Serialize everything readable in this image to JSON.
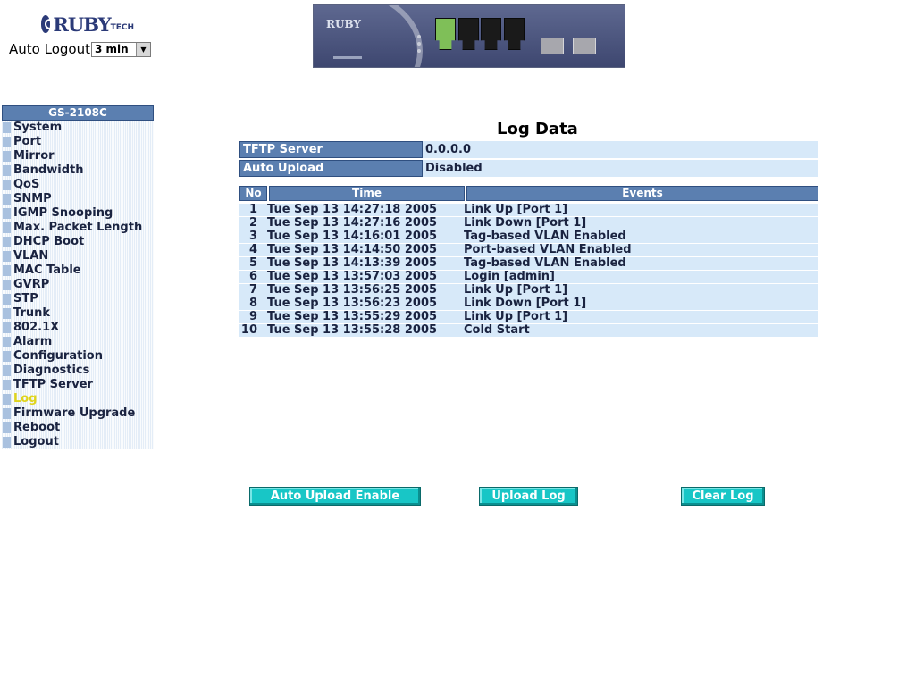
{
  "header": {
    "logo_text": "RUBY",
    "logo_sub": "TECH",
    "auto_logout_label": "Auto Logout",
    "auto_logout_value": "3 min",
    "device_logo": "RUBY"
  },
  "sidebar": {
    "title": "GS-2108C",
    "items": [
      {
        "label": "System"
      },
      {
        "label": "Port"
      },
      {
        "label": "Mirror"
      },
      {
        "label": "Bandwidth"
      },
      {
        "label": "QoS"
      },
      {
        "label": "SNMP"
      },
      {
        "label": "IGMP Snooping"
      },
      {
        "label": "Max. Packet Length"
      },
      {
        "label": "DHCP Boot"
      },
      {
        "label": "VLAN"
      },
      {
        "label": "MAC Table"
      },
      {
        "label": "GVRP"
      },
      {
        "label": "STP"
      },
      {
        "label": "Trunk"
      },
      {
        "label": "802.1X"
      },
      {
        "label": "Alarm"
      },
      {
        "label": "Configuration"
      },
      {
        "label": "Diagnostics"
      },
      {
        "label": "TFTP Server"
      },
      {
        "label": "Log",
        "active": true
      },
      {
        "label": "Firmware Upgrade"
      },
      {
        "label": "Reboot"
      },
      {
        "label": "Logout"
      }
    ]
  },
  "main": {
    "title": "Log Data",
    "info": [
      {
        "label": "TFTP Server",
        "value": "0.0.0.0"
      },
      {
        "label": "Auto Upload",
        "value": "Disabled"
      }
    ],
    "log_table": {
      "headers": {
        "no": "No",
        "time": "Time",
        "events": "Events"
      },
      "rows": [
        {
          "no": "1",
          "time": "Tue Sep 13 14:27:18 2005",
          "event": "Link Up [Port 1]"
        },
        {
          "no": "2",
          "time": "Tue Sep 13 14:27:16 2005",
          "event": "Link Down [Port 1]"
        },
        {
          "no": "3",
          "time": "Tue Sep 13 14:16:01 2005",
          "event": "Tag-based VLAN Enabled"
        },
        {
          "no": "4",
          "time": "Tue Sep 13 14:14:50 2005",
          "event": "Port-based VLAN Enabled"
        },
        {
          "no": "5",
          "time": "Tue Sep 13 14:13:39 2005",
          "event": "Tag-based VLAN Enabled"
        },
        {
          "no": "6",
          "time": "Tue Sep 13 13:57:03 2005",
          "event": "Login [admin]"
        },
        {
          "no": "7",
          "time": "Tue Sep 13 13:56:25 2005",
          "event": "Link Up [Port 1]"
        },
        {
          "no": "8",
          "time": "Tue Sep 13 13:56:23 2005",
          "event": "Link Down [Port 1]"
        },
        {
          "no": "9",
          "time": "Tue Sep 13 13:55:29 2005",
          "event": "Link Up [Port 1]"
        },
        {
          "no": "10",
          "time": "Tue Sep 13 13:55:28 2005",
          "event": "Cold Start"
        }
      ]
    },
    "buttons": {
      "auto_upload": "Auto Upload Enable",
      "upload_log": "Upload Log",
      "clear_log": "Clear Log"
    }
  },
  "colors": {
    "header_blue": "#5b7fb0",
    "row_light": "#d7e9f9",
    "button_cyan": "#18c6c6",
    "active_menu": "#e0d41c"
  }
}
